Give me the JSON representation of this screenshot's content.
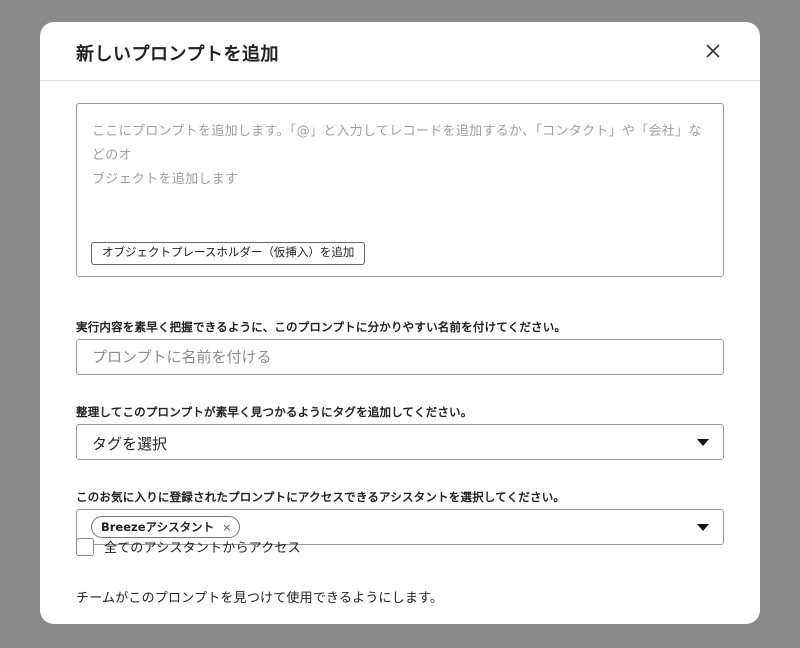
{
  "dialog": {
    "title": "新しいプロンプトを追加",
    "close_icon": "close-icon"
  },
  "prompt_editor": {
    "placeholder_line1": "ここにプロンプトを追加します。「@」と入力してレコードを追加するか、「コンタクト」や「会社」などのオ",
    "placeholder_line2": "ブジェクトを追加します",
    "insert_placeholder_button": "オブジェクトプレースホルダー（仮挿入）を追加"
  },
  "name_field": {
    "label": "実行内容を素早く把握できるように、このプロンプトに分かりやすい名前を付けてください。",
    "placeholder": "プロンプトに名前を付ける",
    "value": ""
  },
  "tag_field": {
    "label": "整理してこのプロンプトが素早く見つかるようにタグを追加してください。",
    "selected": "タグを選択"
  },
  "assistant_field": {
    "label": "このお気に入りに登録されたプロンプトにアクセスできるアシスタントを選択してください。",
    "chips": [
      "Breezeアシスタント"
    ],
    "chip_remove_glyph": "×"
  },
  "all_assistants": {
    "label": "全てのアシスタントからアクセス",
    "checked": false
  },
  "footer": {
    "text": "チームがこのプロンプトを見つけて使用できるようにします。"
  }
}
